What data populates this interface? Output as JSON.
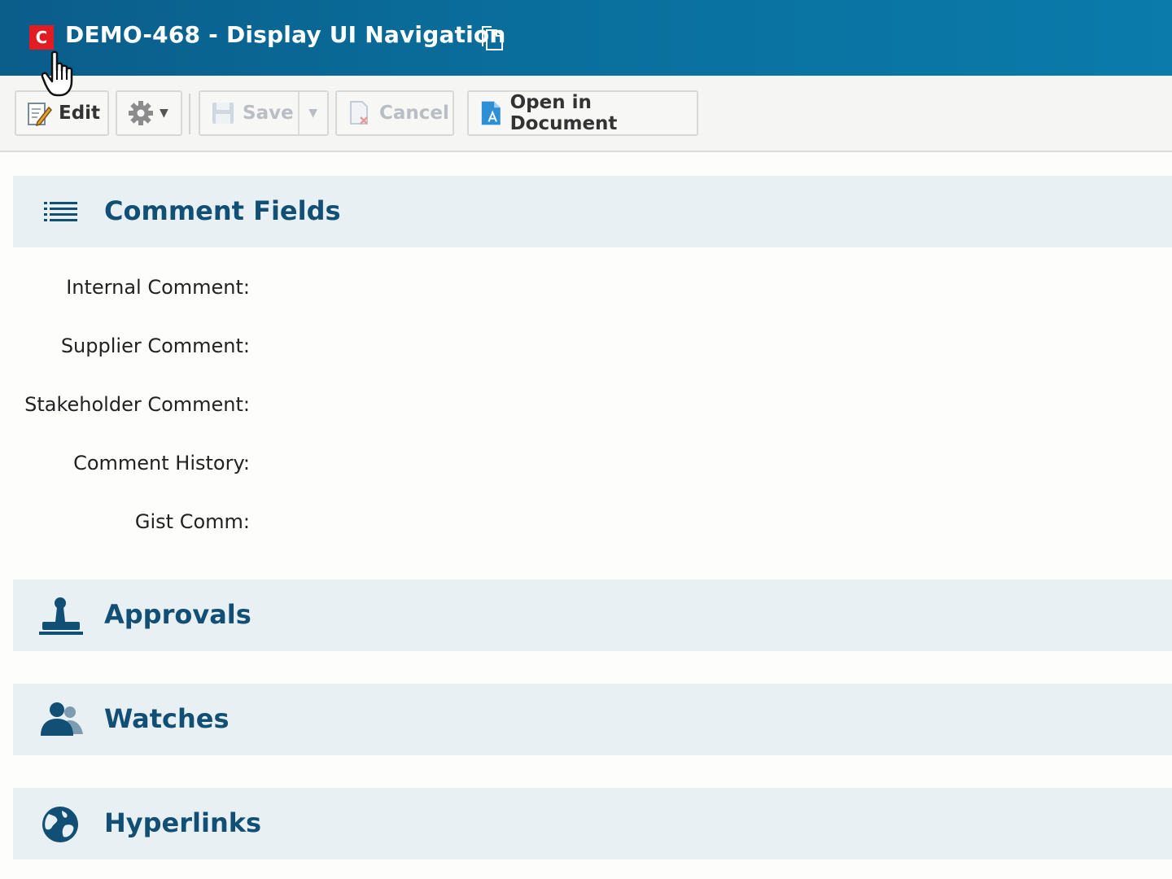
{
  "header": {
    "type_badge": "C",
    "title": "DEMO-468 - Display UI Navigation"
  },
  "toolbar": {
    "edit_label": "Edit",
    "save_label": "Save",
    "cancel_label": "Cancel",
    "open_in_document_label": "Open in Document"
  },
  "sections": {
    "comment_fields": {
      "title": "Comment Fields",
      "fields": [
        {
          "label": "Internal Comment:"
        },
        {
          "label": "Supplier Comment:"
        },
        {
          "label": "Stakeholder Comment:"
        },
        {
          "label": "Comment History:"
        },
        {
          "label": "Gist Comm:"
        }
      ]
    },
    "approvals": {
      "title": "Approvals"
    },
    "watches": {
      "title": "Watches"
    },
    "hyperlinks": {
      "title": "Hyperlinks"
    }
  },
  "colors": {
    "header_bg": "#0a6e9c",
    "badge_red": "#e31b23",
    "section_title": "#114f74",
    "section_bg": "#e9f0f3"
  },
  "icons": [
    "copy-icon",
    "edit-icon",
    "gear-icon",
    "save-icon",
    "cancel-icon",
    "open-document-icon",
    "list-icon",
    "stamp-icon",
    "users-icon",
    "globe-icon",
    "hand-cursor-icon"
  ]
}
